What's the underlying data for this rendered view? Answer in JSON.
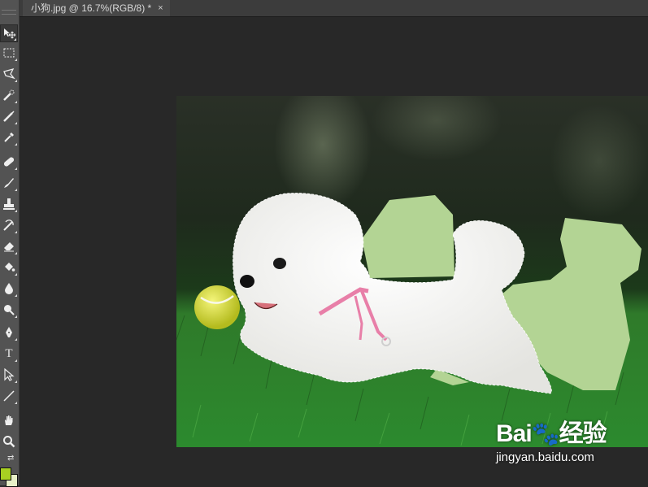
{
  "document_tab": {
    "title": "小狗.jpg @ 16.7%(RGB/8) *",
    "close_glyph": "×"
  },
  "tools": [
    {
      "name": "move-tool",
      "icon": "move-icon"
    },
    {
      "name": "marquee-tool",
      "icon": "rect-marquee-icon"
    },
    {
      "name": "lasso-tool",
      "icon": "lasso-icon"
    },
    {
      "name": "quick-selection-tool",
      "icon": "quick-selection-icon"
    },
    {
      "name": "crop-tool",
      "icon": "crop-icon"
    },
    {
      "name": "eyedropper-tool",
      "icon": "eyedropper-icon"
    },
    {
      "name": "healing-brush-tool",
      "icon": "bandage-icon"
    },
    {
      "name": "brush-tool",
      "icon": "brush-icon"
    },
    {
      "name": "clone-stamp-tool",
      "icon": "stamp-icon"
    },
    {
      "name": "history-brush-tool",
      "icon": "history-brush-icon"
    },
    {
      "name": "eraser-tool",
      "icon": "eraser-icon"
    },
    {
      "name": "paint-bucket-tool",
      "icon": "paint-bucket-icon"
    },
    {
      "name": "blur-tool",
      "icon": "drop-icon"
    },
    {
      "name": "dodge-tool",
      "icon": "dodge-icon"
    },
    {
      "name": "pen-tool",
      "icon": "pen-icon"
    },
    {
      "name": "type-tool",
      "icon": "type-icon",
      "label": "T"
    },
    {
      "name": "path-selection-tool",
      "icon": "arrow-icon"
    },
    {
      "name": "line-tool",
      "icon": "line-icon"
    },
    {
      "name": "hand-tool",
      "icon": "hand-icon"
    },
    {
      "name": "zoom-tool",
      "icon": "magnifier-icon"
    }
  ],
  "colors": {
    "foreground": "#a8d022",
    "background": "#e8f0c8",
    "fill_selection": "#b3d494"
  },
  "watermark": {
    "logo_text": "Bai",
    "logo_suffix": "经验",
    "url": "jingyan.baidu.com"
  }
}
